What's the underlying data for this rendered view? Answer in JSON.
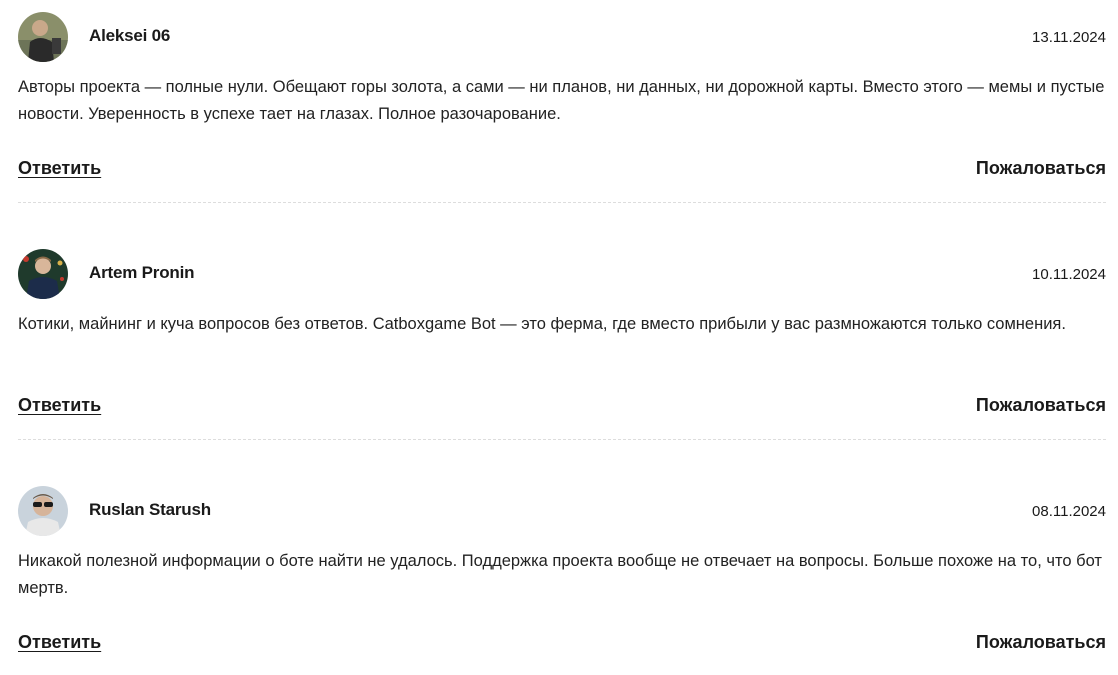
{
  "comments": [
    {
      "author": "Aleksei 06",
      "date": "13.11.2024",
      "text": "Авторы проекта — полные нули. Обещают горы золота, а сами — ни планов, ни данных, ни дорожной карты. Вместо этого — мемы и пустые новости. Уверенность в успехе тает на глазах. Полное разочарование.",
      "reply_label": "Ответить",
      "report_label": "Пожаловаться"
    },
    {
      "author": "Artem Pronin",
      "date": "10.11.2024",
      "text": "Котики, майнинг и куча вопросов без ответов. Catboxgame Bot — это ферма, где вместо прибыли у вас размножаются только сомнения.",
      "reply_label": "Ответить",
      "report_label": "Пожаловаться"
    },
    {
      "author": "Ruslan Starush",
      "date": "08.11.2024",
      "text": "Никакой полезной информации о боте найти не удалось. Поддержка проекта вообще не отвечает на вопросы. Больше похоже на то, что бот мертв.",
      "reply_label": "Ответить",
      "report_label": "Пожаловаться"
    }
  ]
}
